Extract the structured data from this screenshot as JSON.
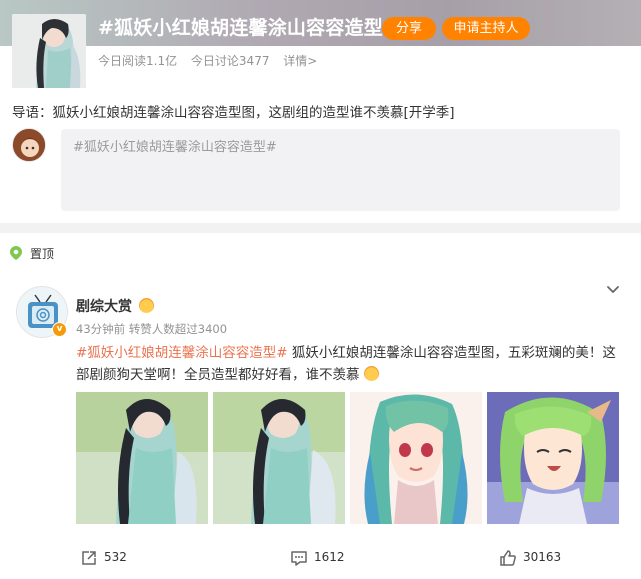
{
  "topic": {
    "title": "#狐妖小红娘胡连馨涂山容容造型#",
    "share_label": "分享",
    "host_label": "申请主持人",
    "reads": "今日阅读1.1亿",
    "discussions": "今日讨论3477",
    "detail_label": "详情>"
  },
  "intro": "导语：狐妖小红娘胡连馨涂山容容造型图，这剧组的造型谁不羡慕[开学季]",
  "compose": {
    "value": "#狐妖小红娘胡连馨涂山容容造型#"
  },
  "post": {
    "pin_label": "置顶",
    "author": "剧综大赏",
    "meta": "43分钟前 转赞人数超过3400",
    "hashtag": "#狐妖小红娘胡连馨涂山容容造型#",
    "text_after_hashtag": " 狐妖小红娘胡连馨涂山容容造型图，五彩斑斓的美！这部剧颜狗天堂啊！全员造型都好好看，谁不羡慕",
    "actions": {
      "reposts": "532",
      "comments": "1612",
      "likes": "30163"
    }
  },
  "colors": {
    "accent": "#ff8200",
    "hashtag": "#eb7350",
    "muted": "#939393"
  },
  "icons": {
    "pin": "pin-icon",
    "verified": "verified-badge-icon",
    "chevron": "chevron-down-icon",
    "repost": "repost-icon",
    "comment": "comment-icon",
    "like": "thumbs-up-icon"
  }
}
